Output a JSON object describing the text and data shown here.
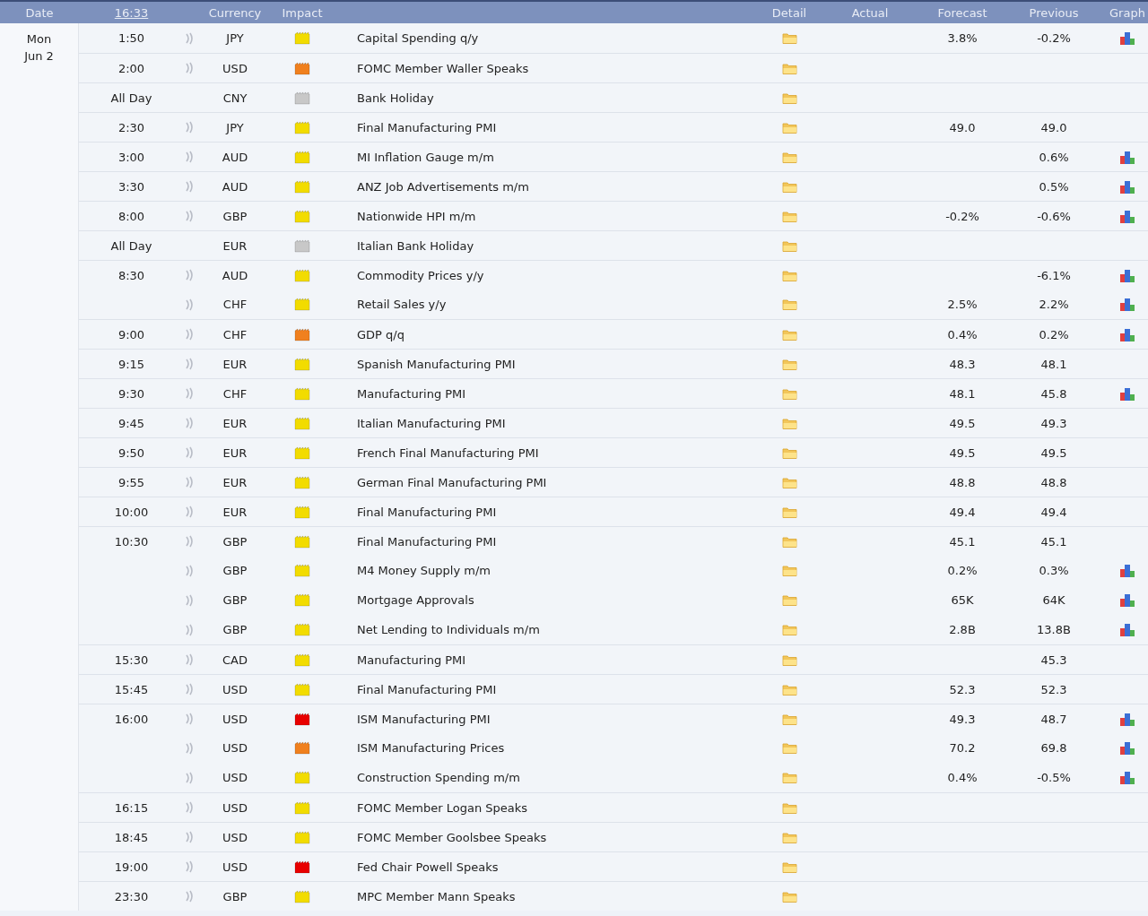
{
  "header": {
    "columns": [
      "Date",
      "16:33",
      "Currency",
      "Impact",
      "Detail",
      "Actual",
      "Forecast",
      "Previous",
      "Graph"
    ]
  },
  "day": {
    "weekday": "Mon",
    "date": "Jun 2"
  },
  "rows": [
    {
      "time": "1:50",
      "alert": true,
      "currency": "JPY",
      "color": "#f2dc00",
      "event": "Capital Spending q/y",
      "forecast": "3.8%",
      "previous": "-0.2%",
      "graph": true
    },
    {
      "time": "2:00",
      "alert": true,
      "currency": "USD",
      "color": "#f0801e",
      "event": "FOMC Member Waller Speaks",
      "graph": false
    },
    {
      "time": "All Day",
      "alert": false,
      "currency": "CNY",
      "color": "#c8c8c8",
      "event": "Bank Holiday",
      "graph": false
    },
    {
      "time": "2:30",
      "alert": true,
      "currency": "JPY",
      "color": "#f2dc00",
      "event": "Final Manufacturing PMI",
      "forecast": "49.0",
      "previous": "49.0",
      "graph": false
    },
    {
      "time": "3:00",
      "alert": true,
      "currency": "AUD",
      "color": "#f2dc00",
      "event": "MI Inflation Gauge m/m",
      "previous": "0.6%",
      "graph": true
    },
    {
      "time": "3:30",
      "alert": true,
      "currency": "AUD",
      "color": "#f2dc00",
      "event": "ANZ Job Advertisements m/m",
      "previous": "0.5%",
      "graph": true
    },
    {
      "time": "8:00",
      "alert": true,
      "currency": "GBP",
      "color": "#f2dc00",
      "event": "Nationwide HPI m/m",
      "forecast": "-0.2%",
      "previous": "-0.6%",
      "graph": true
    },
    {
      "time": "All Day",
      "alert": false,
      "currency": "EUR",
      "color": "#c8c8c8",
      "event": "Italian Bank Holiday",
      "graph": false
    },
    {
      "time": "8:30",
      "alert": true,
      "currency": "AUD",
      "color": "#f2dc00",
      "event": "Commodity Prices y/y",
      "previous": "-6.1%",
      "graph": true
    },
    {
      "alert": true,
      "currency": "CHF",
      "color": "#f2dc00",
      "event": "Retail Sales y/y",
      "forecast": "2.5%",
      "previous": "2.2%",
      "graph": true
    },
    {
      "time": "9:00",
      "alert": true,
      "currency": "CHF",
      "color": "#f0801e",
      "event": "GDP q/q",
      "forecast": "0.4%",
      "previous": "0.2%",
      "graph": true
    },
    {
      "time": "9:15",
      "alert": true,
      "currency": "EUR",
      "color": "#f2dc00",
      "event": "Spanish Manufacturing PMI",
      "forecast": "48.3",
      "previous": "48.1",
      "graph": false
    },
    {
      "time": "9:30",
      "alert": true,
      "currency": "CHF",
      "color": "#f2dc00",
      "event": "Manufacturing PMI",
      "forecast": "48.1",
      "previous": "45.8",
      "graph": true
    },
    {
      "time": "9:45",
      "alert": true,
      "currency": "EUR",
      "color": "#f2dc00",
      "event": "Italian Manufacturing PMI",
      "forecast": "49.5",
      "previous": "49.3",
      "graph": false
    },
    {
      "time": "9:50",
      "alert": true,
      "currency": "EUR",
      "color": "#f2dc00",
      "event": "French Final Manufacturing PMI",
      "forecast": "49.5",
      "previous": "49.5",
      "graph": false
    },
    {
      "time": "9:55",
      "alert": true,
      "currency": "EUR",
      "color": "#f2dc00",
      "event": "German Final Manufacturing PMI",
      "forecast": "48.8",
      "previous": "48.8",
      "graph": false
    },
    {
      "time": "10:00",
      "alert": true,
      "currency": "EUR",
      "color": "#f2dc00",
      "event": "Final Manufacturing PMI",
      "forecast": "49.4",
      "previous": "49.4",
      "graph": false
    },
    {
      "time": "10:30",
      "alert": true,
      "currency": "GBP",
      "color": "#f2dc00",
      "event": "Final Manufacturing PMI",
      "forecast": "45.1",
      "previous": "45.1",
      "graph": false
    },
    {
      "alert": true,
      "currency": "GBP",
      "color": "#f2dc00",
      "event": "M4 Money Supply m/m",
      "forecast": "0.2%",
      "previous": "0.3%",
      "graph": true
    },
    {
      "alert": true,
      "currency": "GBP",
      "color": "#f2dc00",
      "event": "Mortgage Approvals",
      "forecast": "65K",
      "previous": "64K",
      "graph": true
    },
    {
      "alert": true,
      "currency": "GBP",
      "color": "#f2dc00",
      "event": "Net Lending to Individuals m/m",
      "forecast": "2.8B",
      "previous": "13.8B",
      "graph": true
    },
    {
      "time": "15:30",
      "alert": true,
      "currency": "CAD",
      "color": "#f2dc00",
      "event": "Manufacturing PMI",
      "previous": "45.3",
      "graph": false
    },
    {
      "time": "15:45",
      "alert": true,
      "currency": "USD",
      "color": "#f2dc00",
      "event": "Final Manufacturing PMI",
      "forecast": "52.3",
      "previous": "52.3",
      "graph": false
    },
    {
      "time": "16:00",
      "alert": true,
      "currency": "USD",
      "color": "#e80000",
      "event": "ISM Manufacturing PMI",
      "forecast": "49.3",
      "previous": "48.7",
      "graph": true
    },
    {
      "alert": true,
      "currency": "USD",
      "color": "#f0801e",
      "event": "ISM Manufacturing Prices",
      "forecast": "70.2",
      "previous": "69.8",
      "graph": true
    },
    {
      "alert": true,
      "currency": "USD",
      "color": "#f2dc00",
      "event": "Construction Spending m/m",
      "forecast": "0.4%",
      "previous": "-0.5%",
      "graph": true
    },
    {
      "time": "16:15",
      "alert": true,
      "currency": "USD",
      "color": "#f2dc00",
      "event": "FOMC Member Logan Speaks",
      "graph": false
    },
    {
      "time": "18:45",
      "alert": true,
      "currency": "USD",
      "color": "#f2dc00",
      "event": "FOMC Member Goolsbee Speaks",
      "graph": false
    },
    {
      "time": "19:00",
      "alert": true,
      "currency": "USD",
      "color": "#e80000",
      "event": "Fed Chair Powell Speaks",
      "graph": false
    },
    {
      "time": "23:30",
      "alert": true,
      "currency": "GBP",
      "color": "#f2dc00",
      "event": "MPC Member Mann Speaks",
      "graph": false
    }
  ]
}
